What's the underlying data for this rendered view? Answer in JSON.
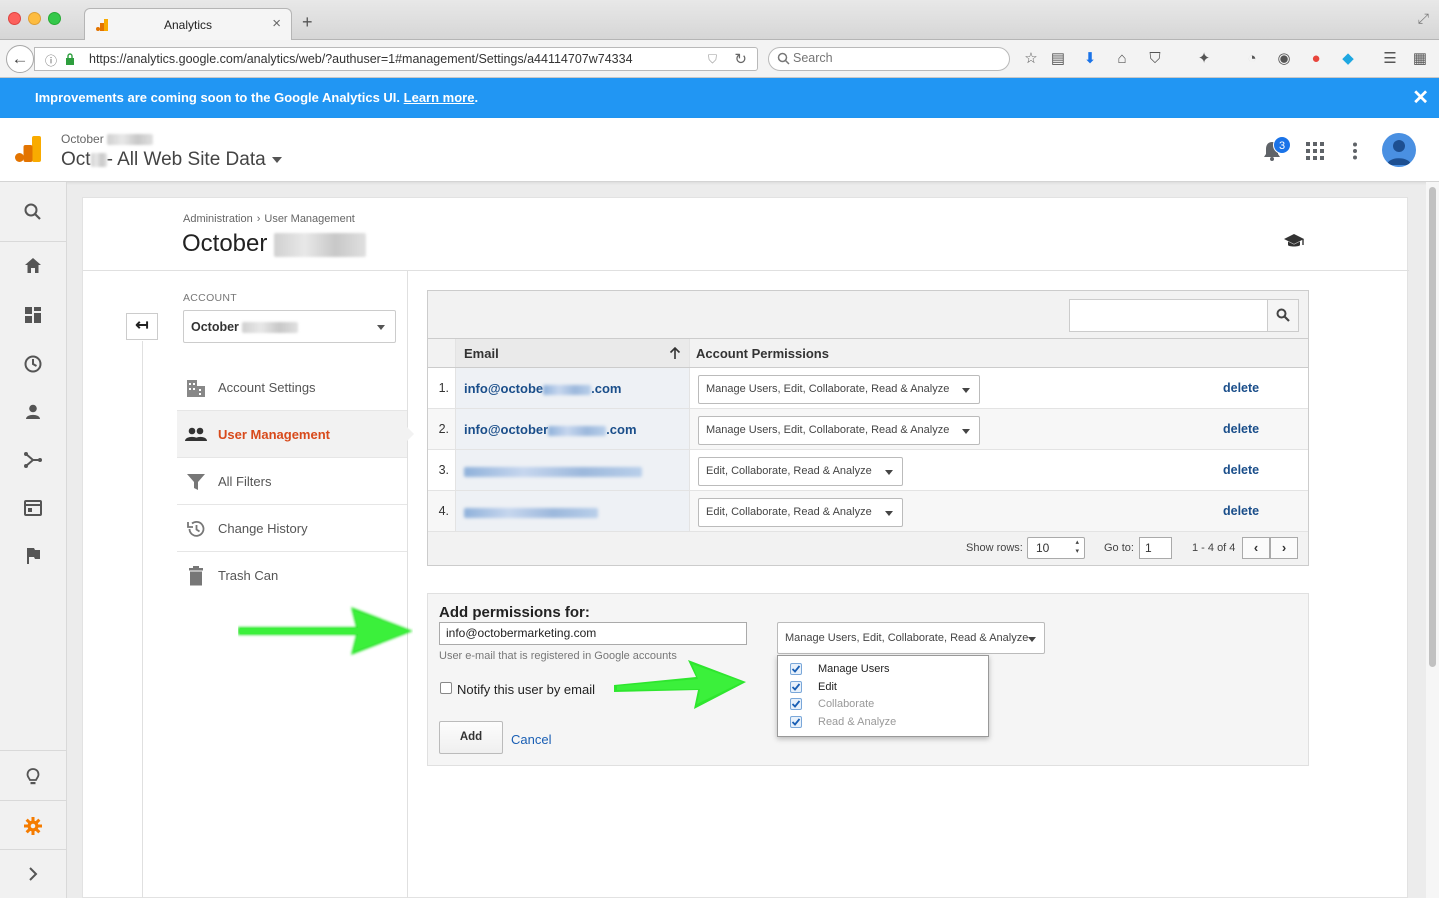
{
  "browser": {
    "tab_title": "Analytics",
    "url": "https://analytics.google.com/analytics/web/?authuser=1#management/Settings/a44114707w74334",
    "search_placeholder": "Search"
  },
  "banner": {
    "text": "Improvements are coming soon to the Google Analytics UI.",
    "link": "Learn more",
    "suffix": ".",
    "close": "✕"
  },
  "header": {
    "account_small": "October",
    "view_prefix": "Oct",
    "view_suffix": "- All Web Site Data",
    "notification_count": "3"
  },
  "breadcrumb": {
    "items": [
      "Administration",
      "User Management"
    ],
    "separator": "›"
  },
  "page_title": "October",
  "account_section": {
    "label": "ACCOUNT",
    "selected": "October"
  },
  "nav": {
    "items": [
      {
        "label": "Account Settings"
      },
      {
        "label": "User Management"
      },
      {
        "label": "All Filters"
      },
      {
        "label": "Change History"
      },
      {
        "label": "Trash Can"
      }
    ]
  },
  "table": {
    "headers": {
      "email": "Email",
      "permissions": "Account Permissions"
    },
    "rows": [
      {
        "num": "1.",
        "email_prefix": "info@octobe",
        "email_suffix": ".com",
        "permission": "Manage Users, Edit, Collaborate, Read & Analyze",
        "action": "delete"
      },
      {
        "num": "2.",
        "email_prefix": "info@october",
        "email_suffix": ".com",
        "permission": "Manage Users, Edit, Collaborate, Read & Analyze",
        "action": "delete"
      },
      {
        "num": "3.",
        "email_prefix": "",
        "email_suffix": "",
        "permission": "Edit, Collaborate, Read & Analyze",
        "action": "delete"
      },
      {
        "num": "4.",
        "email_prefix": "",
        "email_suffix": "",
        "permission": "Edit, Collaborate, Read & Analyze",
        "action": "delete"
      }
    ],
    "pager": {
      "show_rows_label": "Show rows:",
      "rows_value": "10",
      "goto_label": "Go to:",
      "goto_value": "1",
      "range": "1 - 4 of 4",
      "prev": "‹",
      "next": "›"
    }
  },
  "add_permissions": {
    "title": "Add permissions for:",
    "email_value": "info@octobermarketing.com",
    "hint": "User e-mail that is registered in Google accounts",
    "notify_label": "Notify this user by email",
    "add_button": "Add",
    "cancel": "Cancel",
    "permission_value": "Manage Users, Edit, Collaborate, Read & Analyze",
    "options": [
      {
        "label": "Manage Users",
        "checked": true,
        "disabled": false
      },
      {
        "label": "Edit",
        "checked": true,
        "disabled": false
      },
      {
        "label": "Collaborate",
        "checked": true,
        "disabled": true
      },
      {
        "label": "Read & Analyze",
        "checked": true,
        "disabled": true
      }
    ]
  },
  "colors": {
    "banner": "#2196f3",
    "active_nav": "#d84a1b",
    "link": "#1a4e8a",
    "annotation_arrow": "#2ee62e"
  }
}
